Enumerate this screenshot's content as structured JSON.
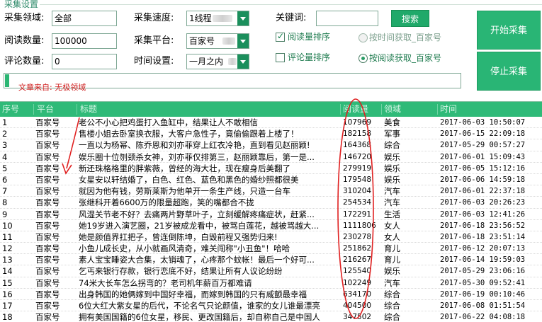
{
  "group_title": "采集设置",
  "fields": {
    "domain_label": "采集领域:",
    "domain_value": "全部",
    "speed_label": "采集速度:",
    "speed_value": "1线程",
    "keyword_label": "关键词:",
    "keyword_value": "",
    "search_label": "搜索",
    "read_count_label": "阅读数量:",
    "read_count_value": "100000",
    "platform_label": "采集平台:",
    "platform_value": "百家号",
    "comment_count_label": "评论数量:",
    "comment_count_value": "0",
    "time_label": "时间设置:",
    "time_value": "一月之内"
  },
  "options": {
    "read_sort_label": "阅读量排序",
    "read_sort_checked": true,
    "comment_sort_label": "评论量排序",
    "comment_sort_checked": false,
    "by_time_label": "按时间获取_百家号",
    "by_time_selected": false,
    "by_read_label": "按阅读获取_百家号",
    "by_read_selected": true
  },
  "buttons": {
    "start": "开始采集",
    "stop": "停止采集"
  },
  "progress": 0.01,
  "source_text": "文章来自: 无极领域",
  "colors": {
    "accent": "#2fba78",
    "button": "#29b575",
    "annotation": "#e02020"
  },
  "table": {
    "headers": [
      "序号",
      "平台",
      "标题",
      "阅读量",
      "领域",
      "时间"
    ],
    "rows": [
      [
        "1",
        "百家号",
        "老公不小心把鸡蛋打入鱼缸中，结果让人不敢相信",
        "107969",
        "美食",
        "2017-06-03 10:50:07"
      ],
      [
        "2",
        "百家号",
        "售楼小姐去卧室换衣服，大客户急性子，竟偷偷跟着上楼了！",
        "182158",
        "军事",
        "2017-06-15 22:09:18"
      ],
      [
        "3",
        "百家号",
        "一直以为杨幂、陈乔恩和刘亦菲穿上红衣冷艳，直到看见赵丽颖!",
        "164368",
        "综合",
        "2017-05-29 00:57:27"
      ],
      [
        "4",
        "百家号",
        "娱乐圈十位刎颈杀女神，刘亦菲仅排第三，赵丽颖靠后，第一是...",
        "146720",
        "娱乐",
        "2017-06-01 15:09:43"
      ],
      [
        "5",
        "百家号",
        "新还珠格格里的胖紫薇，曾经的海大壮，现在瘦身后美翻了",
        "279919",
        "娱乐",
        "2017-06-05 15:12:16"
      ],
      [
        "6",
        "百家号",
        "女星安以轩结婚了，白色、红色、蓝色和黑色的婚纱照都很美",
        "179548",
        "娱乐",
        "2017-06-06 14:59:18"
      ],
      [
        "7",
        "百家号",
        "就因为他有钱，劳斯莱斯为他单开一条生产线，只造一台车",
        "310204",
        "汽车",
        "2017-06-01 22:37:18"
      ],
      [
        "8",
        "百家号",
        "张继科开着6600万的限量超跑，笑的嘴都合不拢",
        "254534",
        "汽车",
        "2017-06-03 20:26:23"
      ],
      [
        "9",
        "百家号",
        "风湿关节老不好？去痛两片野草叶子，立刻缓解疼痛症状，赶紧...",
        "172291",
        "生活",
        "2017-06-03 12:41:26"
      ],
      [
        "10",
        "百家号",
        "她19岁进入演艺圈，21岁被成龙看中，被骂白莲花，越被骂越大...",
        "1111806",
        "女人",
        "2017-06-18 23:56:52"
      ],
      [
        "11",
        "百家号",
        "她是颜值界扛把子，曾连倒陈坤，白毁前程又强势归来!",
        "230278",
        "女人",
        "2017-06-18 23:51:14"
      ],
      [
        "12",
        "百家号",
        "小鱼儿成长史，从小就画风清奇，难关闯称\"小丑鱼\"！哈哈",
        "251862",
        "育儿",
        "2017-06-12 20:07:13"
      ],
      [
        "13",
        "百家号",
        "素人宝宝睡姿大合集，太销魂了，心疼那个蚊帐！最后一个好可...",
        "216267",
        "育儿",
        "2017-06-14 19:59:03"
      ],
      [
        "14",
        "百家号",
        "乞丐来银行存款，银行恋底不好，结果让所有人议论纷纷",
        "125540",
        "娱乐",
        "2017-05-29 23:06:16"
      ],
      [
        "15",
        "百家号",
        "74米大长车怎么拐弯的？老司机年薪百万都难请",
        "102249",
        "汽车",
        "2017-05-30 09:52:41"
      ],
      [
        "16",
        "百家号",
        "出身韩国的她俩嫁到中国好幸福，而嫁到韩国的只有威颤最幸福",
        "634170",
        "综合",
        "2017-06-19 00:10:46"
      ],
      [
        "17",
        "百家号",
        "6位大红大紫女星的后代，不论名气只论颜值，谁家的女儿谁最漂亮",
        "404500",
        "综合",
        "2017-06-08 01:51:54"
      ],
      [
        "18",
        "百家号",
        "拥有美国国籍的6位女星，移民、更改国籍后，却自称自己是中国人",
        "347502",
        "综合",
        "2017-06-22 04:08:18"
      ]
    ]
  }
}
